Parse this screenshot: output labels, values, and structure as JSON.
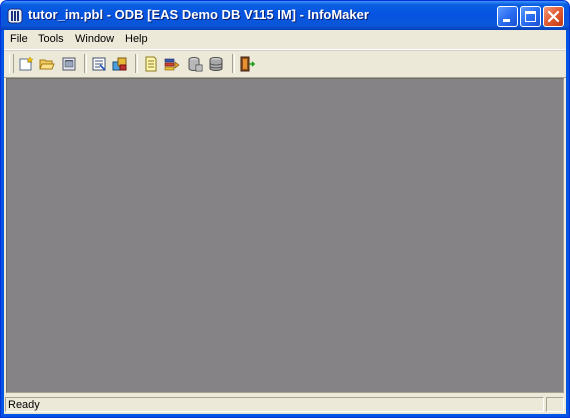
{
  "window": {
    "title": "tutor_im.pbl - ODB [EAS Demo DB V115 IM]  - InfoMaker",
    "app_icon": "infomaker-app-icon",
    "controls": [
      "minimize-icon",
      "maximize-icon",
      "close-icon"
    ]
  },
  "menubar": {
    "items": [
      {
        "label": "File"
      },
      {
        "label": "Tools"
      },
      {
        "label": "Window"
      },
      {
        "label": "Help"
      }
    ]
  },
  "toolbar": {
    "buttons": [
      {
        "icon": "new-icon"
      },
      {
        "icon": "open-folder-icon"
      },
      {
        "icon": "library-painter-icon"
      },
      {
        "icon": "report-painter-icon"
      },
      {
        "icon": "query-painter-icon"
      },
      {
        "icon": "form-painter-icon"
      },
      {
        "icon": "pipeline-icon"
      },
      {
        "icon": "database-profile-icon"
      },
      {
        "icon": "database-painter-icon"
      },
      {
        "icon": "exit-icon"
      }
    ]
  },
  "statusbar": {
    "text": "Ready"
  },
  "colors": {
    "title_bar": "#0554e2",
    "workspace": "#858385",
    "chrome": "#ece9d8"
  }
}
